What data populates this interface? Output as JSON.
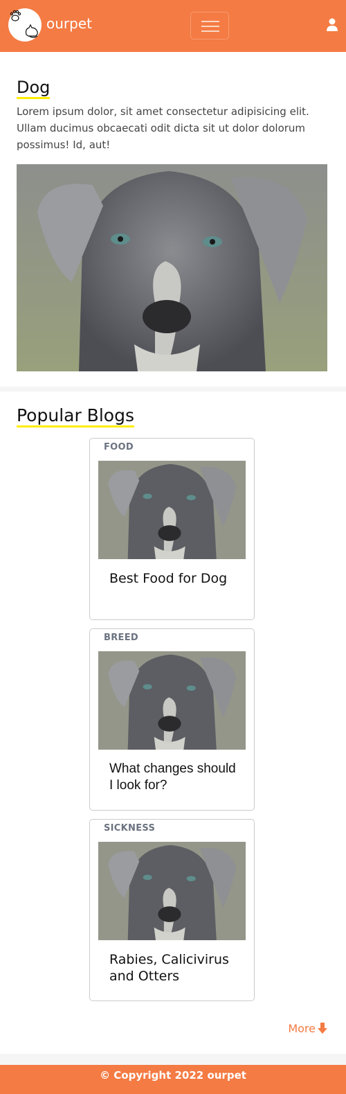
{
  "nav": {
    "brand": "ourpet",
    "logo_icon": "paw-cat-logo",
    "menu_icon": "hamburger-icon",
    "user_icon": "user-icon",
    "accent": "#f47b43"
  },
  "hero": {
    "title": "Dog",
    "text": "Lorem ipsum dolor, sit amet consectetur adipisicing elit. Ullam ducimus obcaecati odit dicta sit ut dolor dolorum possimus! Id, aut!",
    "image_alt": "dog photo"
  },
  "blogs": {
    "heading": "Popular Blogs",
    "cards": [
      {
        "category": "FOOD",
        "title": "Best Food for Dog"
      },
      {
        "category": "BREED",
        "title": "What changes should I look for?"
      },
      {
        "category": "SICKNESS",
        "title": "Rabies, Calicivirus and Otters"
      }
    ],
    "more_label": "More",
    "more_icon": "arrow-down-icon"
  },
  "footer": {
    "text": "© Copyright 2022 ourpet"
  }
}
